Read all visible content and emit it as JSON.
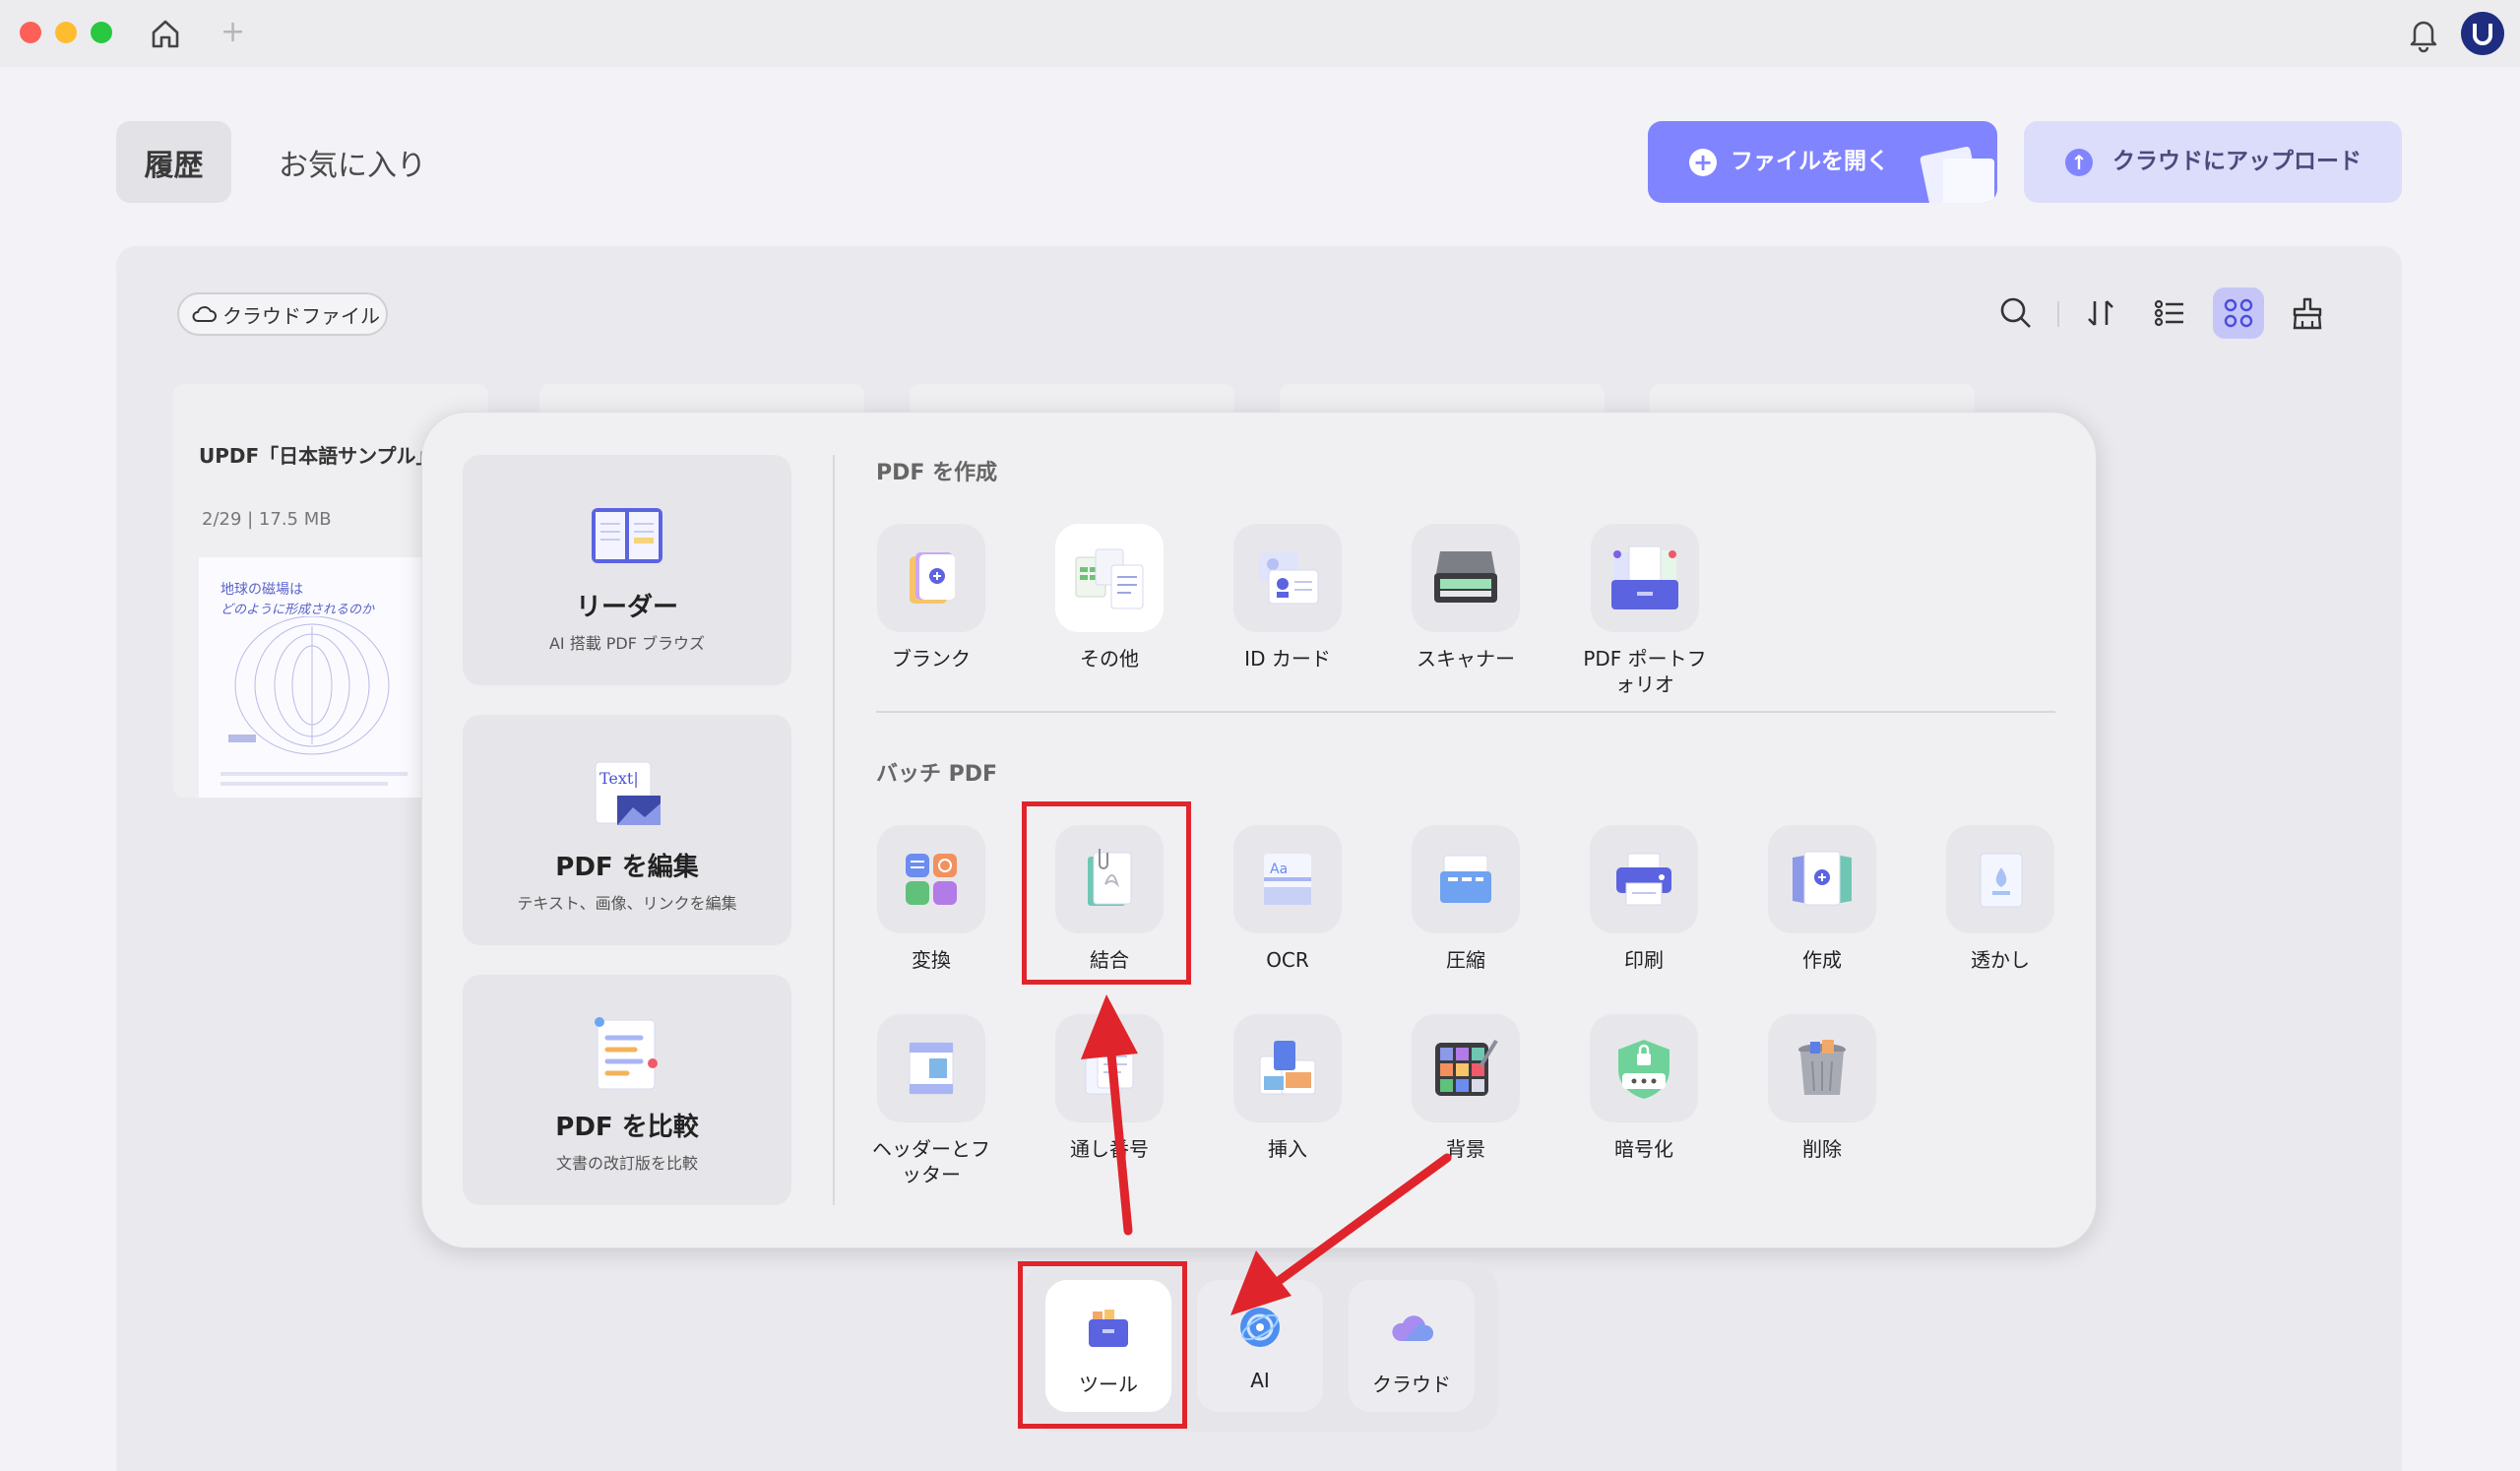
{
  "colors": {
    "accent": "#8184ff",
    "annotation": "#e0242b",
    "traffic_red": "#fe5f57",
    "traffic_yellow": "#febc2e",
    "traffic_green": "#28c840"
  },
  "titlebar": {
    "new_tab": "+",
    "icons": [
      "home-icon",
      "bell-icon",
      "avatar"
    ]
  },
  "header": {
    "tab_history": "履歴",
    "tab_favorites": "お気に入り",
    "open_file": "ファイルを開く",
    "upload_cloud": "クラウドにアップロード"
  },
  "files": {
    "cloud_chip": "クラウドファイル",
    "first_file": {
      "name": "UPDF「日本語サンプル」",
      "meta": "2/29 | 17.5 MB",
      "thumb_title_1": "地球の磁場は",
      "thumb_title_2": "どのように形成されるのか"
    },
    "toolbar_icons": [
      "search-icon",
      "sort-icon",
      "list-view-icon",
      "grid-view-icon",
      "clean-icon"
    ]
  },
  "popup": {
    "left_cards": [
      {
        "title": "リーダー",
        "subtitle": "AI 搭載 PDF ブラウズ"
      },
      {
        "title": "PDF を編集",
        "subtitle": "テキスト、画像、リンクを編集",
        "icon_text": "Text|"
      },
      {
        "title": "PDF を比較",
        "subtitle": "文書の改訂版を比較"
      }
    ],
    "create_section": "PDF を作成",
    "create_tools": [
      "ブランク",
      "その他",
      "ID カード",
      "スキャナー",
      "PDF ポートフォリオ"
    ],
    "batch_section": "バッチ PDF",
    "batch_tools": [
      "変換",
      "結合",
      "OCR",
      "圧縮",
      "印刷",
      "作成",
      "透かし",
      "ヘッダーとフッター",
      "通し番号",
      "挿入",
      "背景",
      "暗号化",
      "削除"
    ]
  },
  "dock": {
    "items": [
      "ツール",
      "AI",
      "クラウド"
    ]
  }
}
